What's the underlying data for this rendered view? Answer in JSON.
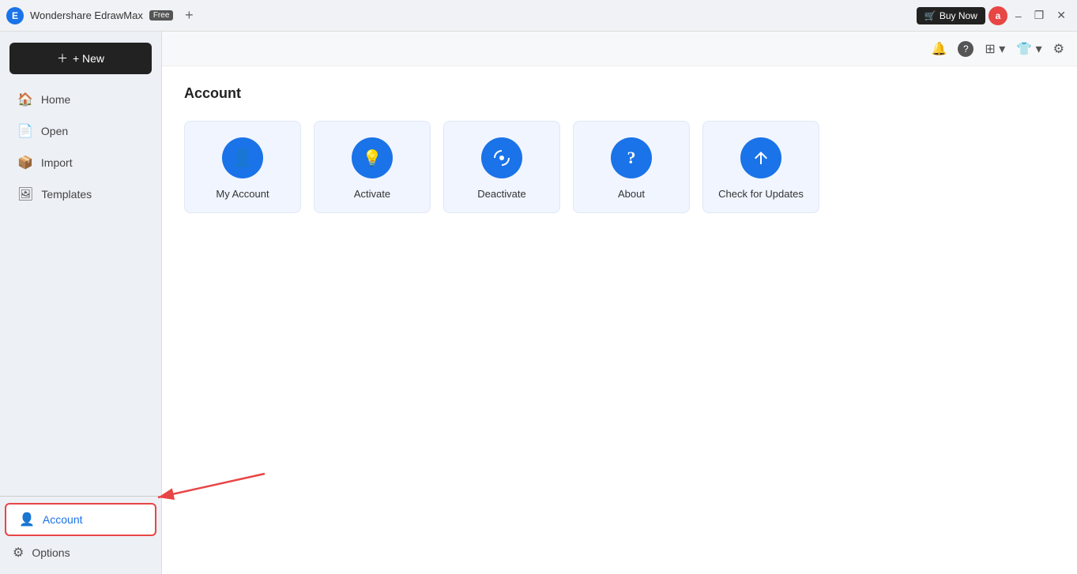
{
  "titlebar": {
    "app_name": "Wondershare EdrawMax",
    "free_badge": "Free",
    "new_tab_icon": "+",
    "buy_now": "Buy Now",
    "user_initial": "a",
    "minimize": "–",
    "maximize": "❐",
    "close": "✕"
  },
  "toolbar_icons": {
    "bell": "🔔",
    "help": "?",
    "grid": "⊞",
    "shirt": "👕",
    "gear": "⚙"
  },
  "sidebar": {
    "new_label": "+ New",
    "nav_items": [
      {
        "id": "home",
        "label": "Home",
        "icon": "🏠"
      },
      {
        "id": "open",
        "label": "Open",
        "icon": "📄"
      },
      {
        "id": "import",
        "label": "Import",
        "icon": "📦"
      },
      {
        "id": "templates",
        "label": "Templates",
        "icon": "🖼"
      }
    ],
    "account_label": "Account",
    "options_label": "Options"
  },
  "content": {
    "title": "Account",
    "cards": [
      {
        "id": "my-account",
        "label": "My Account",
        "icon": "👤"
      },
      {
        "id": "activate",
        "label": "Activate",
        "icon": "💡"
      },
      {
        "id": "deactivate",
        "label": "Deactivate",
        "icon": "🔄"
      },
      {
        "id": "about",
        "label": "About",
        "icon": "?"
      },
      {
        "id": "check-updates",
        "label": "Check for Updates",
        "icon": "↑"
      }
    ]
  }
}
